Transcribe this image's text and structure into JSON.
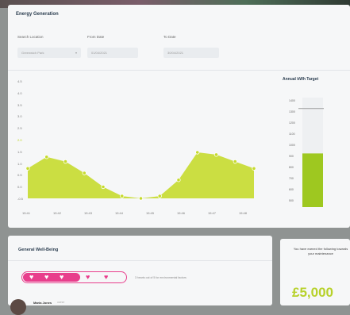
{
  "energy": {
    "title": "Energy Generation",
    "filters": {
      "location": {
        "label": "Search Location",
        "value": "Greenwich Park"
      },
      "from": {
        "label": "From Date",
        "value": "01/04/2021"
      },
      "to": {
        "label": "To Date",
        "value": "30/04/2021"
      }
    },
    "chart_data": {
      "type": "area",
      "title": "",
      "y_ticks": [
        "4.5",
        "4.0",
        "3.5",
        "3.0",
        "2.5",
        "2.0",
        "1.5",
        "1.0",
        "0.5",
        "0.0",
        "-0.5"
      ],
      "x_ticks": [
        "15:41",
        "15:42",
        "15:43",
        "15:44",
        "15:45",
        "15:46",
        "15:47",
        "15:48"
      ],
      "x": [
        0,
        1,
        2,
        3,
        4,
        5,
        6,
        7,
        8,
        9,
        10,
        11,
        12
      ],
      "values": [
        0.8,
        1.3,
        1.1,
        0.6,
        0.0,
        -0.4,
        -0.5,
        -0.4,
        0.3,
        1.5,
        1.4,
        1.1,
        0.8
      ],
      "ylim": [
        -0.5,
        4.5
      ],
      "color": "#c6da2e",
      "series": [
        {
          "name": "",
          "values": [
            0.8,
            1.3,
            1.1,
            0.6,
            0.0,
            -0.4,
            -0.5,
            -0.4,
            0.3,
            1.5,
            1.4,
            1.1,
            0.8
          ]
        }
      ]
    },
    "annual_target": {
      "title": "Annual kWh Target",
      "ticks": [
        "1400",
        "1300",
        "1200",
        "1100",
        "1000",
        "900",
        "800",
        "700",
        "600",
        "500"
      ],
      "target_value": 1300,
      "current_value": 890,
      "ylim": [
        400,
        1400
      ],
      "color": "#9ec820"
    }
  },
  "wellbeing": {
    "title": "General Well-Being",
    "hearts_filled": 3,
    "hearts_total": 5,
    "note": "3 hearts out of 5 for environmental factors",
    "user": {
      "name": "Maria Jones",
      "tag": "owner"
    }
  },
  "savings": {
    "text": "You have earned the following towards your maintenance",
    "amount": "£5,000"
  }
}
